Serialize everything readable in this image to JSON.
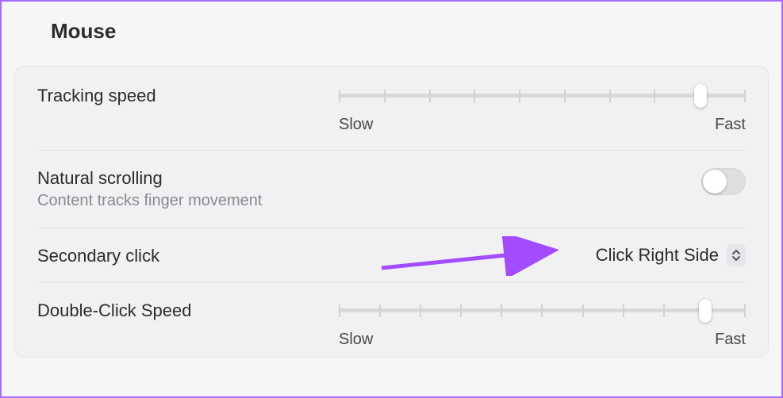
{
  "header": {
    "title": "Mouse"
  },
  "settings": {
    "tracking": {
      "label": "Tracking speed",
      "min_label": "Slow",
      "max_label": "Fast",
      "ticks": 10,
      "value_index": 8
    },
    "natural_scroll": {
      "label": "Natural scrolling",
      "sublabel": "Content tracks finger movement",
      "enabled": false
    },
    "secondary_click": {
      "label": "Secondary click",
      "selected": "Click Right Side"
    },
    "double_click": {
      "label": "Double-Click Speed",
      "min_label": "Slow",
      "max_label": "Fast",
      "ticks": 11,
      "value_index": 9
    }
  },
  "annotation": {
    "arrow_color": "#a24bff"
  }
}
